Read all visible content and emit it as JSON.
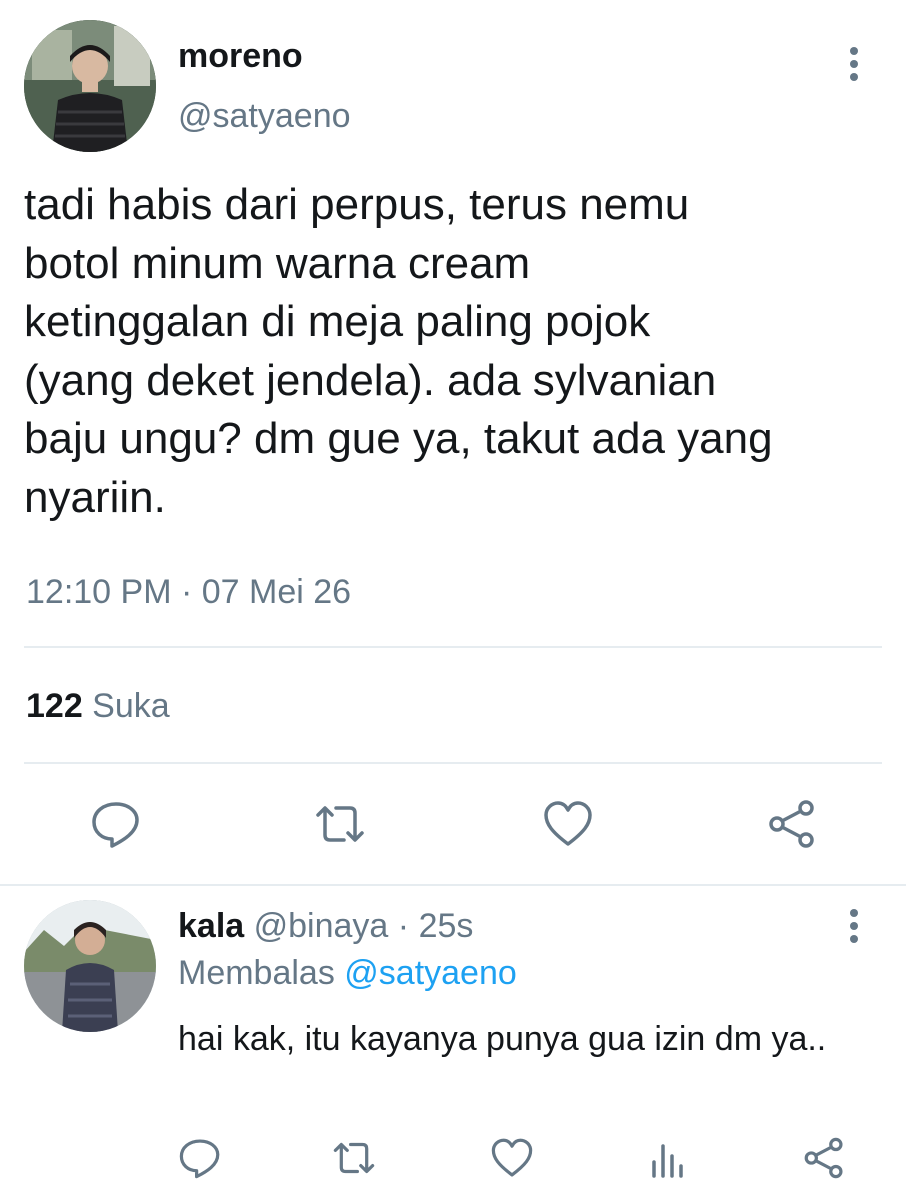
{
  "tweet": {
    "display_name": "moreno",
    "handle": "@satyaeno",
    "text": "tadi habis dari perpus, terus nemu\nbotol minum warna cream\nketinggalan di meja paling pojok\n(yang deket jendela). ada sylvanian\nbaju ungu? dm gue ya, takut ada yang\nnyariin.",
    "time": "12:10 PM",
    "separator": " · ",
    "date": "07 Mei 26",
    "likes_count": "122",
    "likes_label": " Suka",
    "icons": {
      "more": "more-vertical-icon",
      "reply": "reply-bubble-icon",
      "retweet": "retweet-icon",
      "like": "heart-icon",
      "share": "share-icon"
    }
  },
  "reply": {
    "display_name": "kala",
    "handle": " @binaya",
    "separator": " · ",
    "age": "25s",
    "replying_label": "Membalas ",
    "replying_to": "@satyaeno",
    "text": "hai kak, itu kayanya punya gua izin dm ya..",
    "icons": {
      "more": "more-vertical-icon",
      "reply": "reply-bubble-icon",
      "retweet": "retweet-icon",
      "like": "heart-icon",
      "analytics": "analytics-icon",
      "share": "share-icon"
    }
  },
  "colors": {
    "text": "#14171a",
    "secondary": "#657786",
    "link": "#1da1f2",
    "divider": "#e6ecf0"
  }
}
